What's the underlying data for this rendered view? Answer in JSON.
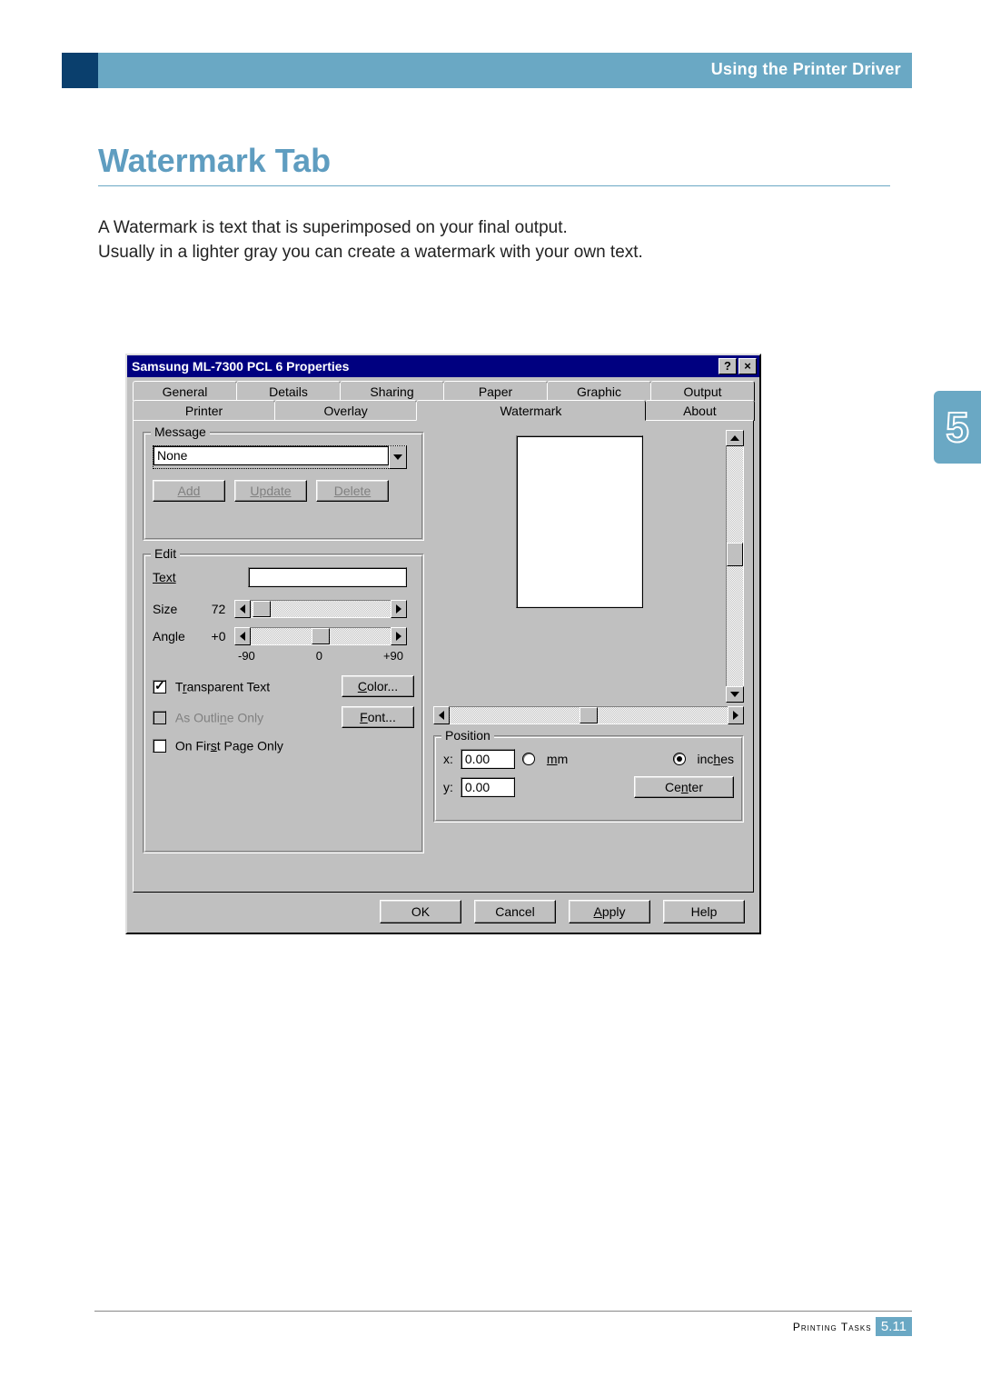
{
  "header": {
    "section_label": "Using the Printer Driver",
    "chapter_number": "5"
  },
  "heading": "Watermark Tab",
  "paragraph1": "A Watermark is text that is superimposed on your final output.",
  "paragraph2": "Usually in a lighter gray you can create a watermark with your own text.",
  "dialog": {
    "title": "Samsung ML-7300 PCL 6 Properties",
    "help_btn": "?",
    "close_btn": "×",
    "tabs_row1": [
      "General",
      "Details",
      "Sharing",
      "Paper",
      "Graphic",
      "Output"
    ],
    "tabs_row2": [
      "Printer",
      "Overlay",
      "Watermark",
      "About"
    ],
    "active_tab": "Watermark",
    "message_group": "Message",
    "message_value": "None",
    "btn_add": "Add",
    "btn_update": "Update",
    "btn_delete": "Delete",
    "edit_group": "Edit",
    "label_text": "Text",
    "text_value": "",
    "label_size": "Size",
    "size_value": "72",
    "label_angle": "Angle",
    "angle_value": "+0",
    "angle_min": "-90",
    "angle_mid": "0",
    "angle_max": "+90",
    "chk_transparent": "Transparent Text",
    "chk_transparent_checked": true,
    "chk_outline": "As Outline Only",
    "chk_outline_enabled": false,
    "chk_firstpage": "On First Page Only",
    "chk_firstpage_checked": false,
    "btn_color": "Color...",
    "btn_font": "Font...",
    "position_group": "Position",
    "pos_x_label": "x:",
    "pos_x_value": "0.00",
    "pos_y_label": "y:",
    "pos_y_value": "0.00",
    "unit_mm": "mm",
    "unit_inches": "inches",
    "unit_selected": "inches",
    "btn_center": "Center",
    "footer": {
      "ok": "OK",
      "cancel": "Cancel",
      "apply": "Apply",
      "help": "Help"
    }
  },
  "page_footer": {
    "section": "Printing Tasks",
    "page": "5.11"
  }
}
